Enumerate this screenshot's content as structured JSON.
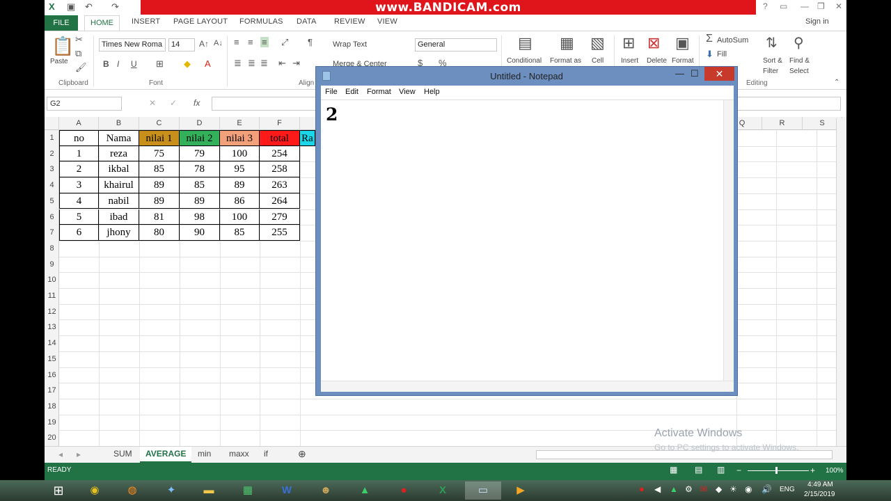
{
  "overlay": {
    "bandicam": "www.BANDICAM.com"
  },
  "excel": {
    "tabs": [
      "FILE",
      "HOME",
      "INSERT",
      "PAGE LAYOUT",
      "FORMULAS",
      "DATA",
      "REVIEW",
      "VIEW"
    ],
    "sign_in": "Sign in",
    "font_name": "Times New Roma",
    "font_size": "14",
    "wrap_text": "Wrap Text",
    "merge_center": "Merge & Center",
    "number_format": "General",
    "groups": {
      "clipboard": "Clipboard",
      "font": "Font",
      "alignment": "Align",
      "editing": "Editing"
    },
    "ribbon": {
      "paste": "Paste",
      "conditional": "Conditional",
      "format_as": "Format as",
      "cell": "Cell",
      "insert": "Insert",
      "delete": "Delete",
      "format": "Format",
      "autosum": "AutoSum",
      "fill": "Fill",
      "sort_1": "Sort &",
      "sort_2": "Filter",
      "find_1": "Find &",
      "find_2": "Select"
    },
    "name_box": "G2",
    "columns": [
      "A",
      "B",
      "C",
      "D",
      "E",
      "F"
    ],
    "columns_right": [
      "Q",
      "R",
      "S"
    ],
    "rows": [
      "1",
      "2",
      "3",
      "4",
      "5",
      "6",
      "7",
      "8",
      "9",
      "10",
      "11",
      "12",
      "13",
      "14",
      "15",
      "16",
      "17",
      "18",
      "19",
      "20"
    ],
    "header_row": [
      "no",
      "Nama",
      "nilai 1",
      "nilai 2",
      "nilai 3",
      "total",
      "Ra"
    ],
    "data": [
      [
        "1",
        "reza",
        "75",
        "79",
        "100",
        "254"
      ],
      [
        "2",
        "ikbal",
        "85",
        "78",
        "95",
        "258"
      ],
      [
        "3",
        "khairul",
        "89",
        "85",
        "89",
        "263"
      ],
      [
        "4",
        "nabil",
        "89",
        "89",
        "86",
        "264"
      ],
      [
        "5",
        "ibad",
        "81",
        "98",
        "100",
        "279"
      ],
      [
        "6",
        "jhony",
        "80",
        "90",
        "85",
        "255"
      ]
    ],
    "header_colors": [
      "#ffffff",
      "#ffffff",
      "#c8901a",
      "#33b05a",
      "#f2a07a",
      "#ff1a1a",
      "#1ad6e6"
    ],
    "sheets": [
      "SUM",
      "AVERAGE",
      "min",
      "maxx",
      "if"
    ],
    "active_sheet": "AVERAGE",
    "status": "READY",
    "zoom": "100%"
  },
  "notepad": {
    "title": "Untitled - Notepad",
    "menu": [
      "File",
      "Edit",
      "Format",
      "View",
      "Help"
    ],
    "content": "2"
  },
  "watermark": {
    "line1": "Activate Windows",
    "line2": "Go to PC settings to activate Windows."
  },
  "taskbar": {
    "time": "4:49 AM",
    "date": "2/15/2019",
    "lang": "ENG"
  }
}
